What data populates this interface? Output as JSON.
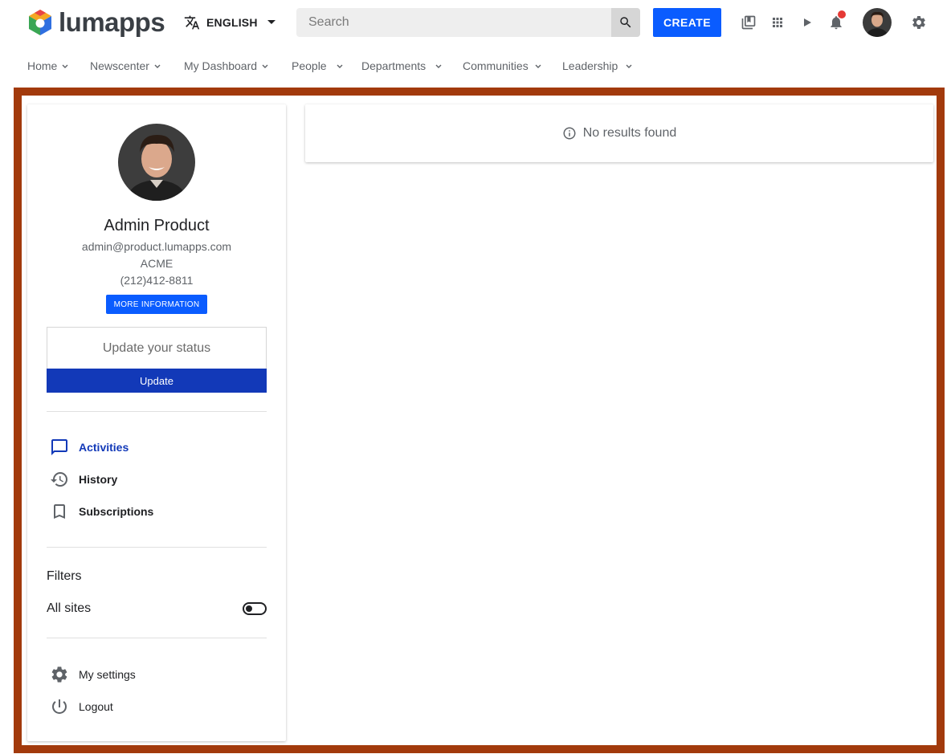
{
  "header": {
    "logo_text": "lumapps",
    "language_label": "ENGLISH",
    "search_placeholder": "Search",
    "create_label": "CREATE",
    "icons": [
      "directory-icon",
      "apps-grid-icon",
      "play-icon",
      "notifications-icon",
      "settings-icon"
    ],
    "notification_dot_color": "#e53935"
  },
  "nav": {
    "items": [
      {
        "label": "Home"
      },
      {
        "label": "Newscenter"
      },
      {
        "label": "My Dashboard"
      },
      {
        "label": "People"
      },
      {
        "label": "Departments"
      },
      {
        "label": "Communities"
      },
      {
        "label": "Leadership"
      }
    ]
  },
  "profile": {
    "name": "Admin Product",
    "email": "admin@product.lumapps.com",
    "organization": "ACME",
    "phone": "(212)412-8811",
    "more_info_label": "MORE INFORMATION",
    "status_placeholder": "Update your status",
    "update_label": "Update"
  },
  "menu": {
    "items": [
      {
        "label": "Activities",
        "icon": "chat-bubble-icon",
        "active": true
      },
      {
        "label": "History",
        "icon": "history-icon",
        "active": false
      },
      {
        "label": "Subscriptions",
        "icon": "bookmark-icon",
        "active": false
      }
    ]
  },
  "filters": {
    "title": "Filters",
    "all_sites_label": "All sites",
    "all_sites_on": false
  },
  "footer_menu": {
    "settings_label": "My settings",
    "logout_label": "Logout"
  },
  "results": {
    "message": "No results found"
  },
  "colors": {
    "primary": "#0a5cff",
    "update_button": "#1239b8",
    "active_menu": "#1239b8",
    "frame_border": "#a23a0c"
  }
}
